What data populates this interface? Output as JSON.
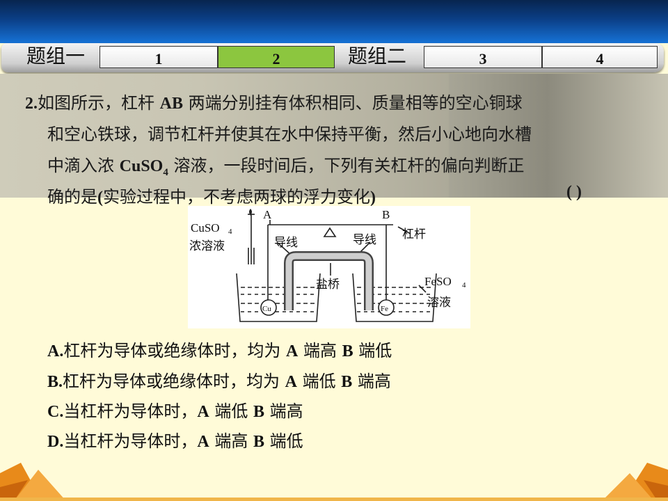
{
  "header": {
    "group1_label": "题组一",
    "group2_label": "题组二",
    "tabs": [
      {
        "label": "1",
        "active": false
      },
      {
        "label": "2",
        "active": true
      },
      {
        "label": "3",
        "active": false
      },
      {
        "label": "4",
        "active": false
      }
    ],
    "colors": {
      "active_tab": "#8cc63f",
      "top_bar": "#0b3f87"
    }
  },
  "question": {
    "number": "2.",
    "line1_a": "如图所示，杠杆 ",
    "line1_b": "AB",
    "line1_c": " 两端分别挂有体积相同、质量相等的空心铜球",
    "line2": "和空心铁球，调节杠杆并使其在水中保持平衡，然后小心地向水槽",
    "line3_a": "中滴入浓 ",
    "line3_b": "CuSO",
    "line3_sub": "4",
    "line3_c": " 溶液，一段时间后，下列有关杠杆的偏向判断正",
    "line4_a": "确的是",
    "line4_b": "(",
    "line4_c": "实验过程中，不考虑两球的浮力变化",
    "line4_d": ")",
    "blank": "(        )"
  },
  "diagram": {
    "label_A": "A",
    "label_B": "B",
    "label_cuso4": "CuSO",
    "label_cuso4_sub": "4",
    "label_conc": "浓溶液",
    "label_wire_left": "导线",
    "label_wire_right": "导线",
    "label_lever": "杠杆",
    "label_saltbridge": "盐桥",
    "label_feso4": "FeSO",
    "label_feso4_sub": "4",
    "label_solution": "溶液",
    "ball_cu": "Cu",
    "ball_fe": "Fe"
  },
  "options": [
    {
      "key": "A.",
      "parts": [
        "杠杆为导体或绝缘体时，均为 ",
        "A",
        " 端高 ",
        "B",
        " 端低"
      ]
    },
    {
      "key": "B.",
      "parts": [
        "杠杆为导体或绝缘体时，均为 ",
        "A",
        " 端低 ",
        "B",
        " 端高"
      ]
    },
    {
      "key": "C.",
      "parts": [
        "当杠杆为导体时，",
        "A",
        " 端低 ",
        "B",
        " 端高"
      ]
    },
    {
      "key": "D.",
      "parts": [
        "当杠杆为导体时，",
        "A",
        " 端高 ",
        "B",
        " 端低"
      ]
    }
  ]
}
